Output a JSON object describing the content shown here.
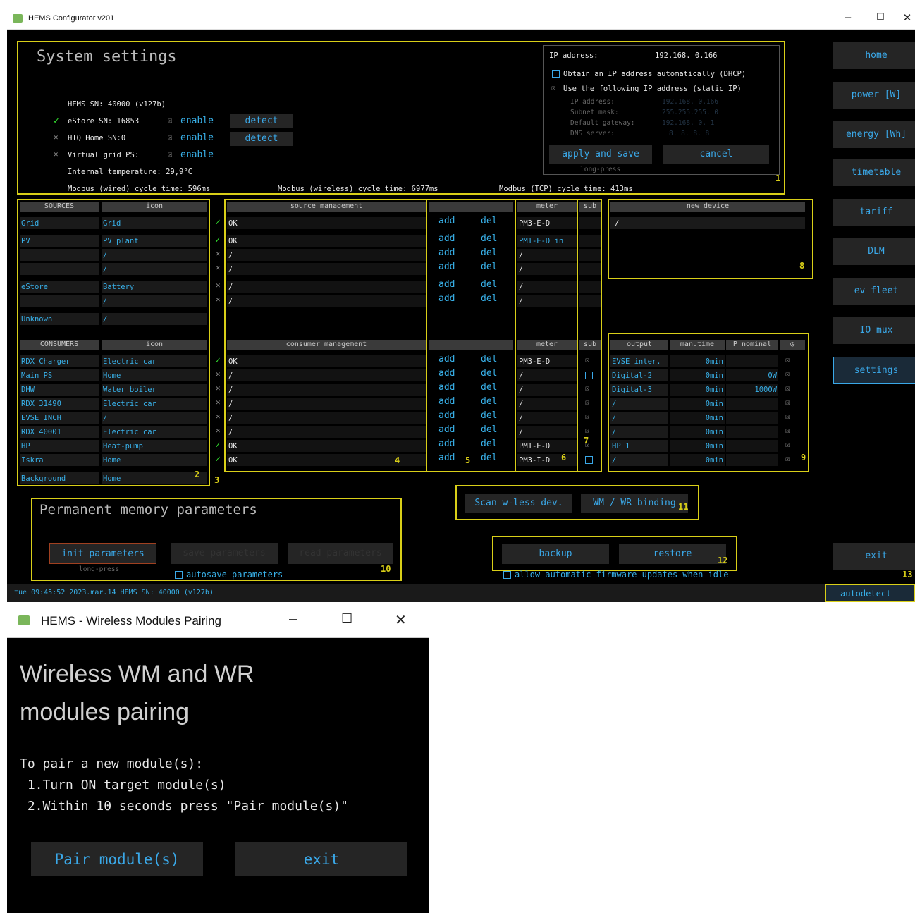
{
  "window": {
    "title": "HEMS Configurator v201"
  },
  "system": {
    "title": "System settings",
    "hems_sn": "HEMS SN:    40000 (v127b)",
    "estore": "eStore SN:  16853",
    "hiq": "HIQ Home SN:0",
    "vgrid": "Virtual grid PS:",
    "enable": "enable",
    "detect": "detect",
    "temp": "Internal temperature: 29,9°C",
    "cycle_wired": "Modbus (wired) cycle time: 596ms",
    "cycle_wireless": "Modbus (wireless) cycle time: 6977ms",
    "cycle_tcp": "Modbus (TCP) cycle time: 413ms",
    "box_num": "1"
  },
  "ip": {
    "label": "IP address:",
    "value": "192.168.  0.166",
    "dhcp": "Obtain an IP address automatically (DHCP)",
    "static": "Use the following IP address (static IP)",
    "ip_lbl": "IP address:",
    "ip_val": "192.168.  0.166",
    "mask_lbl": "Subnet mask:",
    "mask_val": "255.255.255.  0",
    "gw_lbl": "Default gateway:",
    "gw_val": "192.168.  0.  1",
    "dns_lbl": "DNS server:",
    "dns_val": "8.  8.  8.  8",
    "apply": "apply and save",
    "cancel": "cancel",
    "longpress": "long-press"
  },
  "sources": {
    "h_sources": "SOURCES",
    "h_icon": "icon",
    "h_mgmt": "source management",
    "h_meter": "meter",
    "h_sub": "sub",
    "h_newdev": "new device",
    "newdev_val": "/",
    "rows": [
      {
        "name": "Grid",
        "icon": "Grid",
        "status": "OK",
        "meter": "PM3-E-D"
      },
      {
        "name": "PV",
        "icon": "PV plant",
        "status": "OK",
        "meter": "PM1-E-D  in"
      },
      {
        "name": "",
        "icon": "/",
        "status": "/",
        "meter": "/"
      },
      {
        "name": "",
        "icon": "/",
        "status": "/",
        "meter": "/"
      },
      {
        "name": "eStore",
        "icon": "Battery",
        "status": "/",
        "meter": "/"
      },
      {
        "name": "",
        "icon": "/",
        "status": "/",
        "meter": "/"
      },
      {
        "name": "Unknown",
        "icon": "/",
        "status": "",
        "meter": ""
      }
    ]
  },
  "consumers": {
    "h_consumers": "CONSUMERS",
    "h_icon": "icon",
    "h_mgmt": "consumer management",
    "h_meter": "meter",
    "h_sub": "sub",
    "h_output": "output",
    "h_mantime": "man.time",
    "h_pnom": "P nominal",
    "rows": [
      {
        "name": "RDX Charger",
        "icon": "Electric car",
        "status": "OK",
        "meter": "PM3-E-D",
        "output": "EVSE inter.",
        "mantime": "0min",
        "pnom": ""
      },
      {
        "name": "Main PS",
        "icon": "Home",
        "status": "/",
        "meter": "/",
        "output": "Digital-2",
        "mantime": "0min",
        "pnom": "0W"
      },
      {
        "name": "DHW",
        "icon": "Water boiler",
        "status": "/",
        "meter": "/",
        "output": "Digital-3",
        "mantime": "0min",
        "pnom": "1000W"
      },
      {
        "name": "RDX 31490",
        "icon": "Electric car",
        "status": "/",
        "meter": "/",
        "output": "/",
        "mantime": "0min",
        "pnom": ""
      },
      {
        "name": "EVSE INCH",
        "icon": "/",
        "status": "/",
        "meter": "/",
        "output": "/",
        "mantime": "0min",
        "pnom": ""
      },
      {
        "name": "RDX 40001",
        "icon": "Electric car",
        "status": "/",
        "meter": "/",
        "output": "/",
        "mantime": "0min",
        "pnom": ""
      },
      {
        "name": "HP",
        "icon": "Heat-pump",
        "status": "OK",
        "meter": "PM1-E-D",
        "output": "HP 1",
        "mantime": "0min",
        "pnom": ""
      },
      {
        "name": "Iskra",
        "icon": "Home",
        "status": "OK",
        "meter": "PM3-I-D",
        "output": "/",
        "mantime": "0min",
        "pnom": ""
      }
    ],
    "background_name": "Background",
    "background_icon": "Home"
  },
  "add": "add",
  "del": "del",
  "nums": {
    "n2": "2",
    "n3": "3",
    "n4": "4",
    "n5": "5",
    "n6": "6",
    "n7": "7",
    "n8": "8",
    "n9": "9",
    "n10": "10",
    "n11": "11",
    "n12": "12",
    "n13": "13"
  },
  "perm": {
    "title": "Permanent memory parameters",
    "init": "init parameters",
    "save": "save parameters",
    "read": "read parameters",
    "longpress": "long-press",
    "autosave": "autosave parameters"
  },
  "scan": {
    "scan": "Scan w-less dev.",
    "binding": "WM / WR binding"
  },
  "backup": {
    "backup": "backup",
    "restore": "restore",
    "autoupdate": "allow automatic firmware updates when idle"
  },
  "nav": [
    "home",
    "power [W]",
    "energy [Wh]",
    "timetable",
    "tariff",
    "DLM",
    "ev fleet",
    "IO mux",
    "settings"
  ],
  "nav_exit": "exit",
  "autodetect": "autodetect",
  "status_bar": "tue 09:45:52 2023.mar.14    HEMS SN: 40000 (v127b)",
  "pairing": {
    "window_title": "HEMS - Wireless Modules Pairing",
    "heading1": "Wireless WM and WR",
    "heading2": "modules pairing",
    "instr": "To pair a new module(s):",
    "step1": " 1.Turn ON target module(s)",
    "step2": " 2.Within 10 seconds press \"Pair module(s)\"",
    "pair_btn": "Pair module(s)",
    "exit_btn": "exit"
  },
  "colors": {
    "accent": "#38b0e8",
    "frame": "#d9cf18",
    "ok": "#33e030",
    "bg": "#000000"
  }
}
